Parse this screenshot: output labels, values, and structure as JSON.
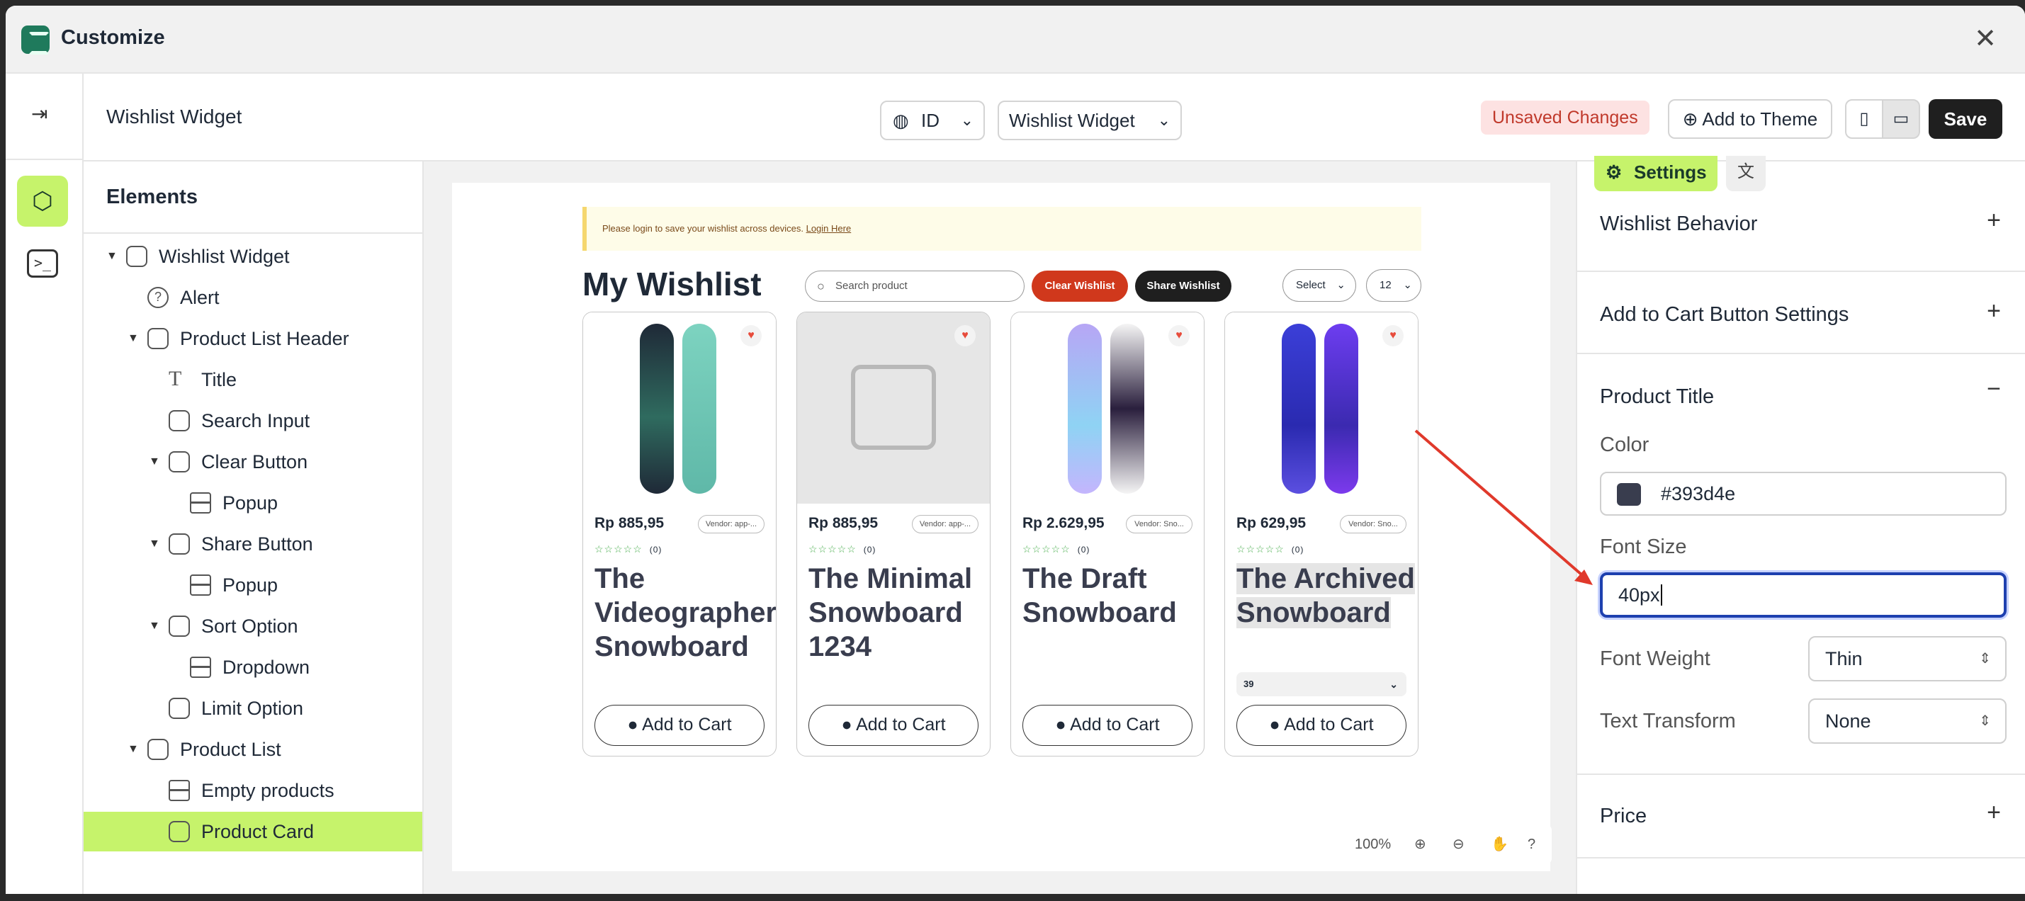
{
  "app": {
    "title": "Customize",
    "close": "✕"
  },
  "rail": {
    "exit_icon": "⇥",
    "elements_icon": "⬡",
    "terminal_icon": ">_"
  },
  "topbar": {
    "page_title": "Wishlist Widget",
    "language": "ID",
    "template": "Wishlist Widget",
    "unsaved": "Unsaved Changes",
    "add_to_theme": "Add to Theme",
    "save": "Save",
    "mobile_icon": "▯",
    "desktop_icon": "▭"
  },
  "elements": {
    "heading": "Elements",
    "items": [
      {
        "label": "Wishlist Widget"
      },
      {
        "label": "Alert"
      },
      {
        "label": "Product List Header"
      },
      {
        "label": "Title"
      },
      {
        "label": "Search Input"
      },
      {
        "label": "Clear Button"
      },
      {
        "label": "Popup"
      },
      {
        "label": "Share Button"
      },
      {
        "label": "Popup"
      },
      {
        "label": "Sort Option"
      },
      {
        "label": "Dropdown"
      },
      {
        "label": "Limit Option"
      },
      {
        "label": "Product List"
      },
      {
        "label": "Empty products"
      },
      {
        "label": "Product Card"
      }
    ]
  },
  "preview": {
    "alert_text": "Please login to save your wishlist across devices.",
    "alert_link": "Login Here",
    "title": "My Wishlist",
    "search_placeholder": "Search product",
    "clear_label": "Clear Wishlist",
    "share_label": "Share Wishlist",
    "sort_label": "Select",
    "limit_label": "12",
    "clear_color": "#d0381c",
    "products": [
      {
        "price": "Rp 885,95",
        "vendor": "Vendor: app-...",
        "reviews": "(0)",
        "title": "The Videographer Snowboard",
        "button": "Add to Cart"
      },
      {
        "price": "Rp 885,95",
        "vendor": "Vendor: app-...",
        "reviews": "(0)",
        "title": "The Minimal Snowboard 1234",
        "button": "Add to Cart"
      },
      {
        "price": "Rp 2.629,95",
        "vendor": "Vendor: Sno...",
        "reviews": "(0)",
        "title": "The Draft Snowboard",
        "button": "Add to Cart"
      },
      {
        "price": "Rp 629,95",
        "vendor": "Vendor: Sno...",
        "reviews": "(0)",
        "title": "The Archived Snowboard",
        "qty": "39",
        "button": "Add to Cart"
      }
    ],
    "zoom": "100%"
  },
  "settings": {
    "tab": "Settings",
    "sections": {
      "behavior": "Wishlist Behavior",
      "cart": "Add to Cart Button Settings",
      "title": "Product Title",
      "price": "Price"
    },
    "color_label": "Color",
    "color_value": "#393d4e",
    "font_size_label": "Font Size",
    "font_size_value": "40px",
    "font_weight_label": "Font Weight",
    "font_weight_value": "Thin",
    "transform_label": "Text Transform",
    "transform_value": "None",
    "accent": "#c6f36b"
  }
}
